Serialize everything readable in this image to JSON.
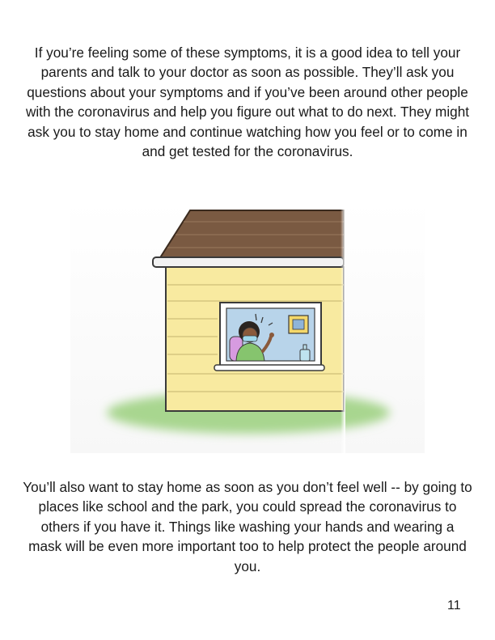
{
  "body": {
    "paragraph_1": "If you’re feeling some of these symptoms, it is a good idea to tell your parents and talk to your doctor as soon as possible. They’ll ask you questions about your symptoms and if you’ve been around other people with the coronavirus and help you figure out what to do next. They might ask you to stay home and continue watching how you feel or to come in and get tested for the coronavirus.",
    "paragraph_2": "You’ll also want to stay home as soon as you don’t feel well -- by going to places like school and the park, you could spread the coronavirus to others if you have it. Things like washing your hands and wearing a mask will be even more important too to help protect the people around you."
  },
  "footer": {
    "page_number": "11"
  },
  "colors": {
    "siding": "#f8eaa0",
    "roof": "#7a5a42",
    "window_glass": "#b8d4ea",
    "grass": "#a8d68f",
    "mask": "#9fd8ec"
  }
}
